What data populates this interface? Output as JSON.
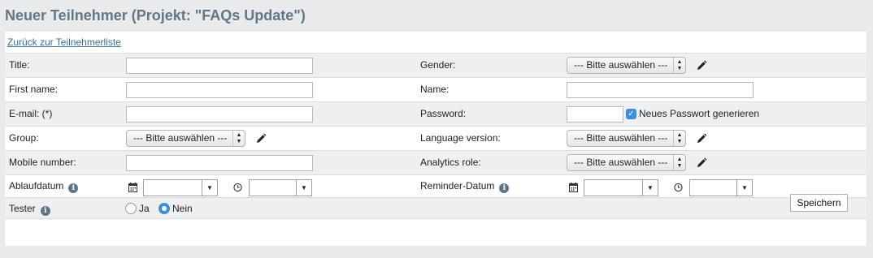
{
  "page": {
    "title": "Neuer Teilnehmer (Projekt: \"FAQs Update\")",
    "back_link": "Zurück zur Teilnehmerliste"
  },
  "form": {
    "title_label": "Title:",
    "gender_label": "Gender:",
    "gender_value": "--- Bitte auswählen ---",
    "first_name_label": "First name:",
    "name_label": "Name:",
    "email_label": "E-mail: (*)",
    "password_label": "Password:",
    "generate_password_label": "Neues Passwort generieren",
    "generate_password_checked": true,
    "group_label": "Group:",
    "group_value": "--- Bitte auswählen ---",
    "language_label": "Language version:",
    "language_value": "--- Bitte auswählen ---",
    "mobile_label": "Mobile number:",
    "analytics_label": "Analytics role:",
    "analytics_value": "--- Bitte auswählen ---",
    "expiry_label": "Ablaufdatum",
    "reminder_label": "Reminder-Datum",
    "tester_label": "Tester",
    "tester_yes": "Ja",
    "tester_no": "Nein",
    "tester_selected": "Nein",
    "save_label": "Speichern"
  },
  "icons": {
    "info": "info-icon",
    "edit": "pencil-icon",
    "calendar": "calendar-icon",
    "clock": "clock-icon"
  },
  "colors": {
    "title": "#5f7787",
    "link": "#3b6f97",
    "accent": "#3d8ee3",
    "row_shade": "#eeeff1"
  }
}
